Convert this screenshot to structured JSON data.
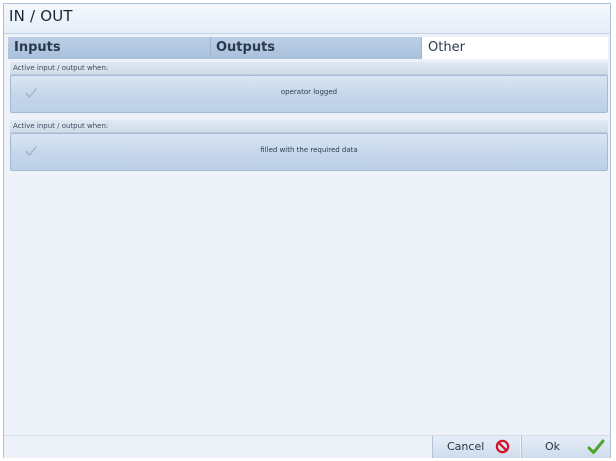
{
  "window": {
    "title": "IN / OUT"
  },
  "tabs": [
    {
      "label": "Inputs",
      "selected": false
    },
    {
      "label": "Outputs",
      "selected": false
    },
    {
      "label": "Other",
      "selected": true
    }
  ],
  "sections": [
    {
      "header": "Active input / output when:",
      "option_label": "operator logged",
      "checked": false
    },
    {
      "header": "Active input / output when:",
      "option_label": "filled with the required data",
      "checked": false
    }
  ],
  "footer": {
    "cancel_label": "Cancel",
    "ok_label": "Ok"
  },
  "icons": {
    "check": "check-icon",
    "cancel": "no-entry-icon",
    "ok": "green-check-icon"
  },
  "colors": {
    "cancel_icon": "#d0142a",
    "ok_icon": "#4aa52a",
    "tab_active": "#ffffff",
    "tab_inactive": "#b3c8e1"
  }
}
